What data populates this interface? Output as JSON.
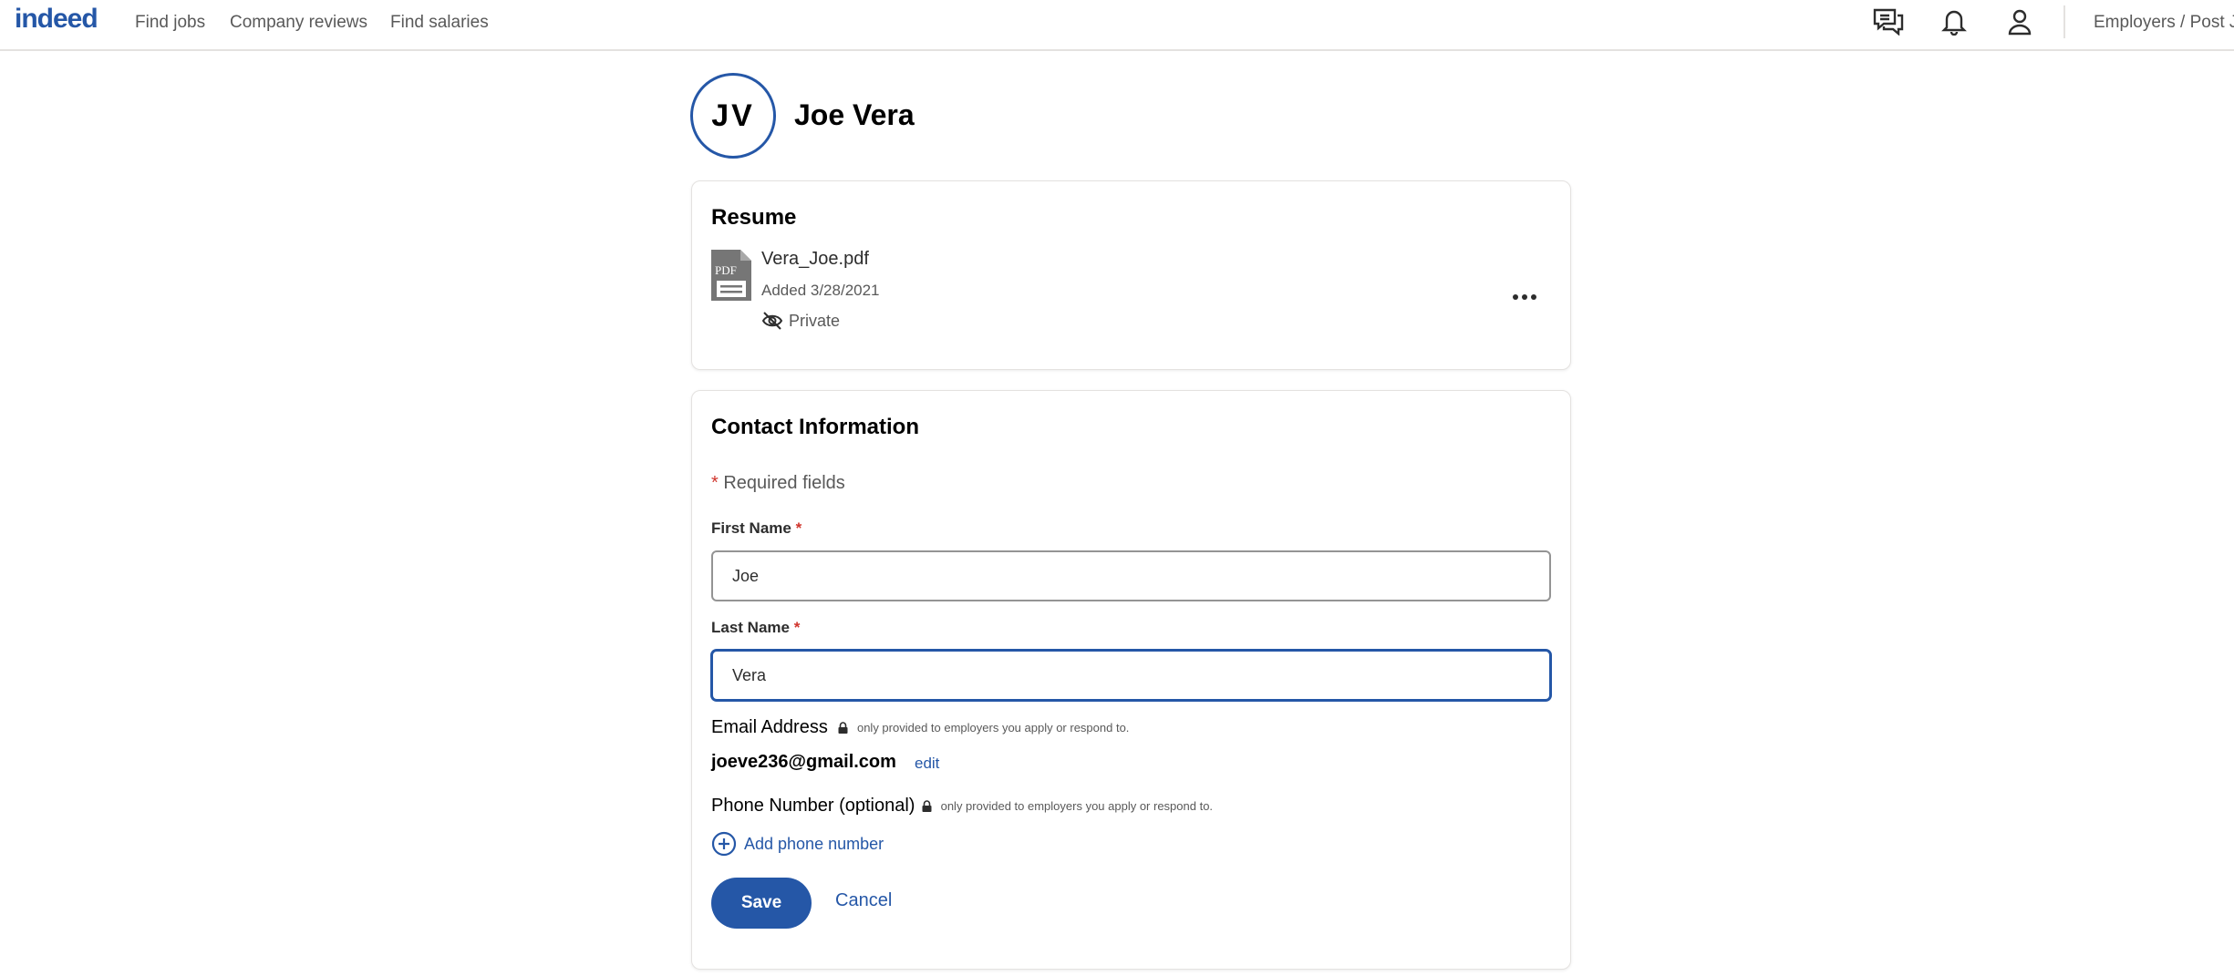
{
  "header": {
    "logo": "indeed",
    "nav": [
      "Find jobs",
      "Company reviews",
      "Find salaries"
    ],
    "icons": [
      "messages-icon",
      "notifications-bell-icon",
      "profile-icon"
    ],
    "employers_link": "Employers / Post Job"
  },
  "profile": {
    "initials": "JV",
    "name": "Joe Vera"
  },
  "resume": {
    "title": "Resume",
    "file_icon": "pdf-file-icon",
    "file_icon_text": "PDF",
    "file_name": "Vera_Joe.pdf",
    "added": "Added 3/28/2021",
    "visibility": "Private",
    "visibility_icon": "eye-slash-icon",
    "menu_icon": "more-horizontal-icon"
  },
  "contact": {
    "title": "Contact Information",
    "required_star": "*",
    "required_note": "Required fields",
    "first_name": {
      "label": "First Name",
      "value": "Joe"
    },
    "last_name": {
      "label": "Last Name",
      "value": "Vera"
    },
    "email": {
      "label": "Email Address",
      "note": "only provided to employers you apply or respond to.",
      "value": "joeve236@gmail.com",
      "edit_label": "edit"
    },
    "phone": {
      "label": "Phone Number (optional)",
      "note": "only provided to employers you apply or respond to.",
      "add_label": "Add phone number"
    },
    "save_label": "Save",
    "cancel_label": "Cancel"
  },
  "colors": {
    "brand_blue": "#2557a7",
    "required_red": "#d0342c",
    "border_gray": "#e4e2e0"
  }
}
